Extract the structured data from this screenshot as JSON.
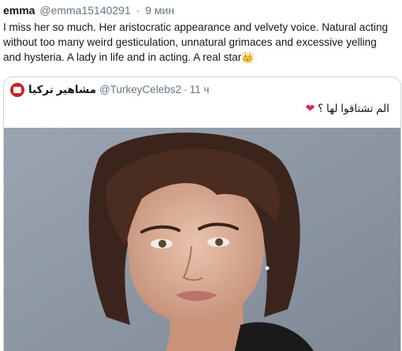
{
  "tweet": {
    "author_name": "emma",
    "author_handle": "@emma15140291",
    "separator": "·",
    "time": "9 мин",
    "text": "I miss her so much. Her aristocratic appearance and velvety voice. Natural acting without too many weird gesticulation, unnatural grimaces and excessive yelling and hysteria. A lady in life and in acting. A real star",
    "text_emoji": "👑"
  },
  "quoted_tweet": {
    "author_name": "مشاهير تركيا",
    "author_handle": "@TurkeyCelebs2",
    "separator": "·",
    "time": "11 ч",
    "text": "الم تشتاقوا لها ؟",
    "text_emoji": "❤",
    "image_icon": "portrait-photo"
  },
  "colors": {
    "text": "#14171a",
    "muted": "#657786",
    "border": "#ccd6dd",
    "heart": "#e0245e",
    "avatar": "#c62828"
  }
}
